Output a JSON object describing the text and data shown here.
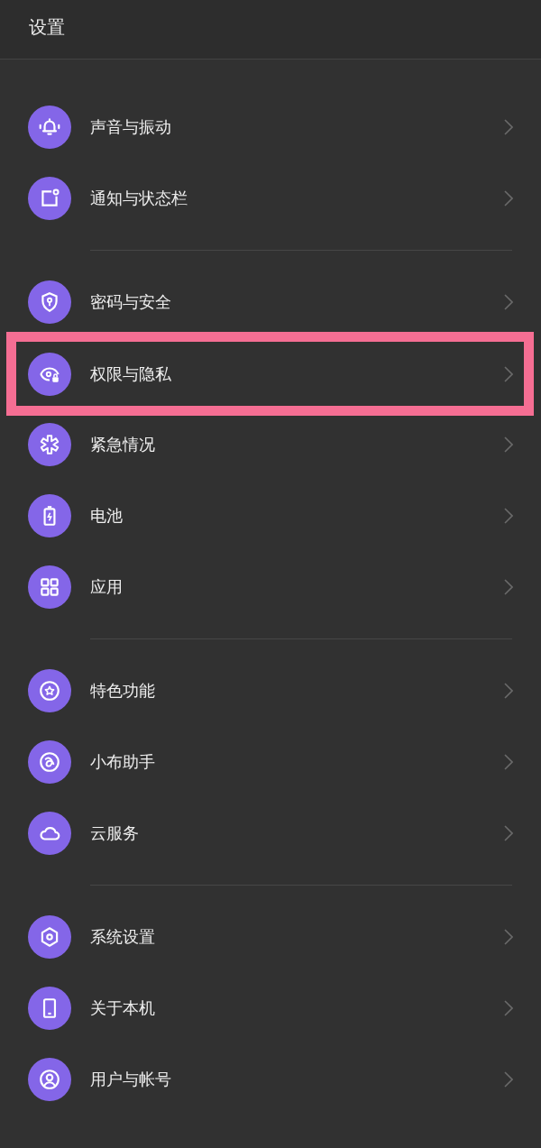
{
  "header": {
    "title": "设置"
  },
  "groups": [
    {
      "items": [
        {
          "label": "声音与振动",
          "highlighted": false
        },
        {
          "label": "通知与状态栏",
          "highlighted": false
        }
      ]
    },
    {
      "items": [
        {
          "label": "密码与安全",
          "highlighted": false
        },
        {
          "label": "权限与隐私",
          "highlighted": true
        },
        {
          "label": "紧急情况",
          "highlighted": false
        },
        {
          "label": "电池",
          "highlighted": false
        },
        {
          "label": "应用",
          "highlighted": false
        }
      ]
    },
    {
      "items": [
        {
          "label": "特色功能",
          "highlighted": false
        },
        {
          "label": "小布助手",
          "highlighted": false
        },
        {
          "label": "云服务",
          "highlighted": false
        }
      ]
    },
    {
      "items": [
        {
          "label": "系统设置",
          "highlighted": false
        },
        {
          "label": "关于本机",
          "highlighted": false
        },
        {
          "label": "用户与帐号",
          "highlighted": false
        }
      ]
    }
  ]
}
